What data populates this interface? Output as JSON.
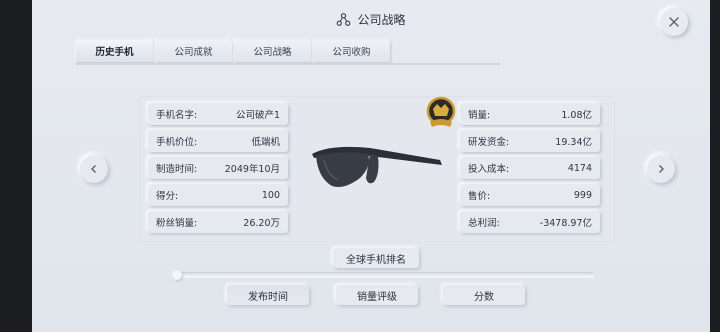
{
  "header": {
    "title": "公司战略",
    "title_icon": "strategy-icon"
  },
  "tabs": [
    {
      "label": "历史手机",
      "active": true
    },
    {
      "label": "公司成就",
      "active": false
    },
    {
      "label": "公司战略",
      "active": false
    },
    {
      "label": "公司收购",
      "active": false
    }
  ],
  "phone": {
    "left_fields": [
      {
        "label": "手机名字:",
        "value": "公司破产1"
      },
      {
        "label": "手机价位:",
        "value": "低端机"
      },
      {
        "label": "制造时间:",
        "value": "2049年10月"
      },
      {
        "label": "得分:",
        "value": "100"
      },
      {
        "label": "粉丝销量:",
        "value": "26.20万"
      }
    ],
    "right_fields": [
      {
        "label": "销量:",
        "value": "1.08亿"
      },
      {
        "label": "研发资金:",
        "value": "19.34亿"
      },
      {
        "label": "投入成本:",
        "value": "4174"
      },
      {
        "label": "售价:",
        "value": "999"
      },
      {
        "label": "总利润:",
        "value": "-3478.97亿"
      }
    ],
    "image_icon": "sunglasses-icon",
    "badge_icon": "award-badge-icon"
  },
  "ranking_button": "全球手机排名",
  "sort_buttons": [
    "发布时间",
    "销量评级",
    "分数"
  ],
  "colors": {
    "background": "#e3e7ed",
    "text": "#2f3542",
    "gold": "#c99a2e"
  }
}
